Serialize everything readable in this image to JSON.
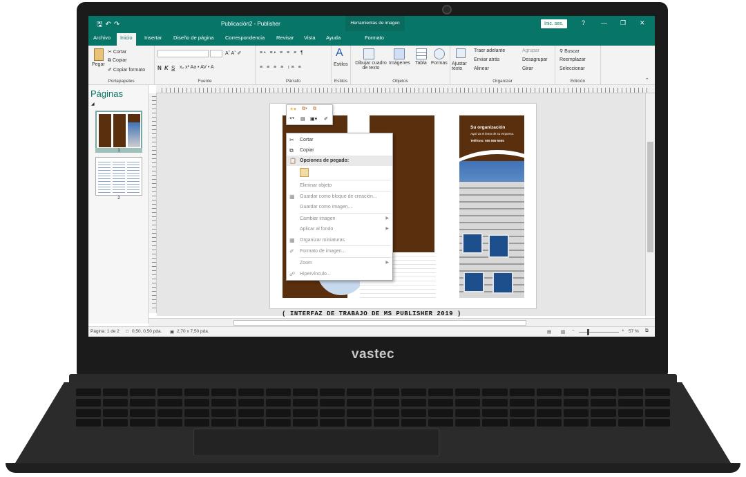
{
  "device": {
    "brand": "vastec"
  },
  "app": {
    "document_title": "Publicación2 - Publisher",
    "context_title": "Herramientas de imagen",
    "sign_in": "Inic. ses.",
    "help": "?"
  },
  "tabs": [
    "Archivo",
    "Inicio",
    "Insertar",
    "Diseño de página",
    "Correspondencia",
    "Revisar",
    "Vista",
    "Ayuda",
    "Formato"
  ],
  "ribbon": {
    "clipboard": {
      "paste": "Pegar",
      "cut": "Cortar",
      "copy": "Copiar",
      "format_painter": "Copiar formato",
      "label": "Portapapeles"
    },
    "font": {
      "bold": "N",
      "italic": "K",
      "underline": "S",
      "label": "Fuente"
    },
    "paragraph": {
      "label": "Párrafo"
    },
    "styles": {
      "button": "Estilos",
      "label": "Estilos"
    },
    "objects": {
      "draw_text_box": "Dibujar cuadro de texto",
      "images": "Imágenes",
      "table": "Tabla",
      "shapes": "Formas",
      "label": "Objetos"
    },
    "arrange": {
      "wrap_text": "Ajustar texto",
      "bring_forward": "Traer adelante",
      "send_backward": "Enviar atrás",
      "align": "Alinear",
      "group": "Agrupar",
      "ungroup": "Desagrupar",
      "rotate": "Girar",
      "label": "Organizar"
    },
    "editing": {
      "find": "Buscar",
      "replace": "Reemplazar",
      "select": "Seleccionar",
      "label": "Edición"
    }
  },
  "pages_pane": {
    "title": "Páginas",
    "pages": [
      "1",
      "2"
    ]
  },
  "document": {
    "org_name": "Su organización",
    "org_tagline": "Aquí va el lema de su empresa.",
    "org_phone": "Teléfono: 555 555 5555"
  },
  "context_menu": {
    "items": [
      {
        "label": "Cortar",
        "icon": "scissors-icon",
        "disabled": false
      },
      {
        "label": "Copiar",
        "icon": "copy-icon",
        "disabled": false
      },
      {
        "label": "Opciones de pegado:",
        "icon": "paste-icon",
        "header": true
      },
      {
        "label": "Eliminar objeto",
        "icon": "",
        "disabled": false
      },
      {
        "label": "Guardar como bloque de creación...",
        "icon": "building-block-icon",
        "disabled": false
      },
      {
        "label": "Guardar como imagen...",
        "icon": "",
        "disabled": false
      },
      {
        "label": "Cambiar imagen",
        "icon": "",
        "submenu": true
      },
      {
        "label": "Aplicar al fondo",
        "icon": "",
        "submenu": true
      },
      {
        "label": "Organizar miniaturas",
        "icon": "thumbnails-icon",
        "disabled": false
      },
      {
        "label": "Formato de imagen...",
        "icon": "format-picture-icon",
        "disabled": false
      },
      {
        "label": "Zoom",
        "icon": "",
        "submenu": true
      },
      {
        "label": "Hipervínculo...",
        "icon": "hyperlink-icon",
        "disabled": false
      }
    ]
  },
  "caption": "( INTERFAZ DE TRABAJO DE MS PUBLISHER 2019 )",
  "status_bar": {
    "page": "Página: 1 de 2",
    "position": "0,50, 0,50 pda.",
    "size": "2,70 x 7,50 pda.",
    "zoom": "57 %"
  },
  "colors": {
    "accent": "#077568",
    "brochure_brown": "#5a2f0e",
    "sky_blue": "#3f72b6"
  }
}
